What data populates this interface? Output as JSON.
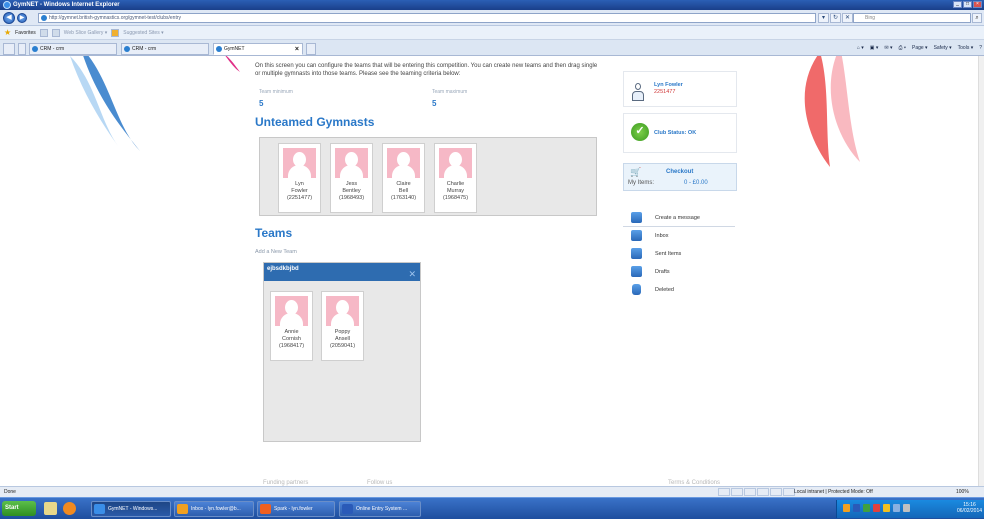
{
  "window": {
    "title": "GymNET - Windows Internet Explorer"
  },
  "addressbar": {
    "url": "http://gymnet.british-gymnastics.org/gymnet-test/clubs/entry",
    "search_placeholder": "Bing"
  },
  "favorites": {
    "label": "Favorites",
    "items": [
      "Web Slice Gallery ▾",
      "Suggested Sites ▾"
    ]
  },
  "tabs": [
    {
      "label": "CRM - crm"
    },
    {
      "label": "CRM - crm"
    },
    {
      "label": "GymNET"
    }
  ],
  "commandbar": {
    "items": [
      "Page ▾",
      "Safety ▾",
      "Tools ▾"
    ]
  },
  "main": {
    "intro": "On this screen you can configure the teams that will be entering this competition. You can create new teams and then drag single or multiple gymnasts into those teams. Please see the teaming criteria below:",
    "team_min_label": "Team minimum",
    "team_min_value": "5",
    "team_max_label": "Team maximum",
    "team_max_value": "5",
    "unteamed_title": "Unteamed Gymnasts",
    "unteamed": [
      {
        "first": "Lyn",
        "last": "Fowler",
        "id": "(2251477)"
      },
      {
        "first": "Jess",
        "last": "Bentley",
        "id": "(1968493)"
      },
      {
        "first": "Claire",
        "last": "Bell",
        "id": "(1763140)"
      },
      {
        "first": "Charlie",
        "last": "Murray",
        "id": "(1968475)"
      }
    ],
    "teams_title": "Teams",
    "add_team_label": "Add a New Team",
    "team": {
      "name": "ejbsdkbjbd",
      "close": "✕",
      "members": [
        {
          "first": "Annie",
          "last": "Cornish",
          "id": "(1968417)"
        },
        {
          "first": "Poppy",
          "last": "Ansell",
          "id": "(2059041)"
        }
      ]
    }
  },
  "side": {
    "user_name": "Lyn Fowler",
    "user_id": "2251477",
    "club_status": "Club Status: OK",
    "checkout_title": "Checkout",
    "my_items_label": "My Items:",
    "my_items_value": "0  -  £0.00",
    "menu": [
      "Create a message",
      "Inbox",
      "Sent Items",
      "Drafts",
      "Deleted"
    ]
  },
  "footer": {
    "funding": "Funding partners",
    "follow": "Follow us",
    "terms": "Terms & Conditions"
  },
  "statusbar": {
    "left": "Done",
    "zone": "Local intranet | Protected Mode: Off",
    "zoom": "100%"
  },
  "taskbar": {
    "start": "Start",
    "buttons": [
      "GymNET - Windows...",
      "Inbox - lyn.fowler@b...",
      "Spark - lyn.fowler",
      "Online Entry System ..."
    ],
    "time": "15:16",
    "date": "06/02/2014"
  },
  "colors": {
    "accent": "#2a78c8",
    "team_header": "#2e6cb0",
    "avatar_pink": "#f6b8c6"
  }
}
